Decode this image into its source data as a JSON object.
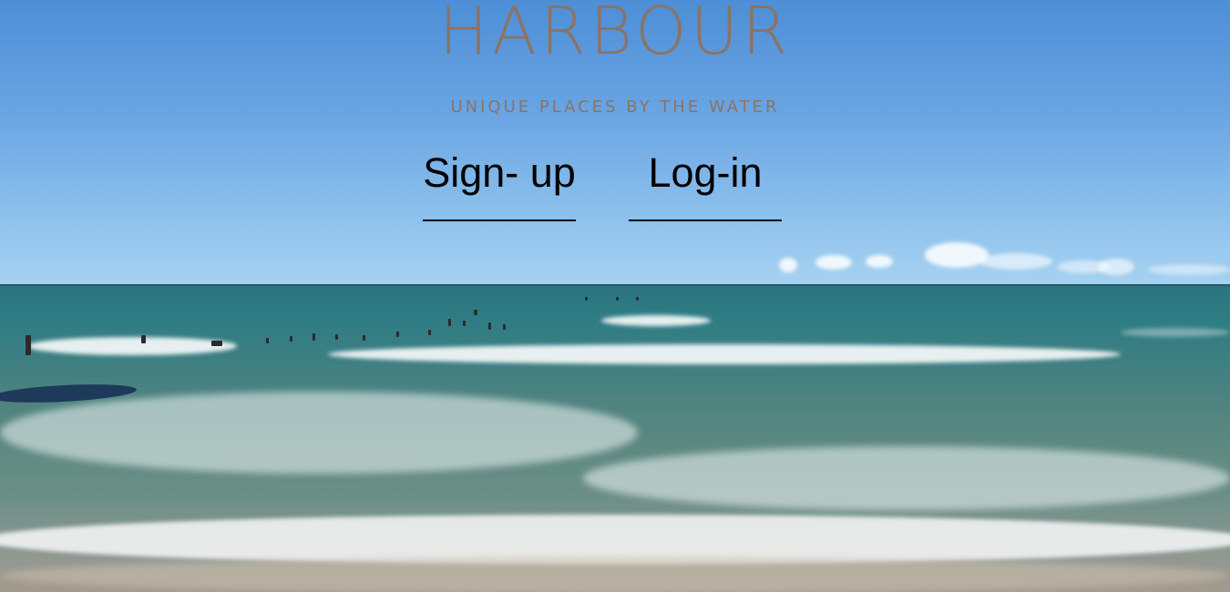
{
  "brand": {
    "name": "HARBOUR",
    "tagline": "UNIQUE PLACES BY THE WATER",
    "color": "#8a7466"
  },
  "auth": {
    "signup_label": "Sign- up",
    "login_label": "Log-in"
  },
  "background": {
    "description_icon": "sea-beach-photo",
    "sky_color": "#6aa5e3",
    "sea_color": "#2f7d84"
  }
}
